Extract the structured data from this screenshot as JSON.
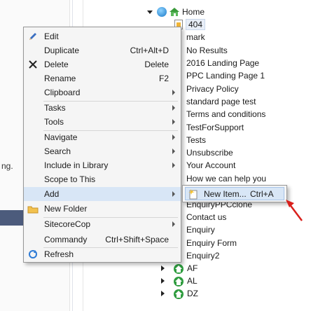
{
  "tree": {
    "root": "Home",
    "items": [
      {
        "label": "404",
        "icon": "doc-icon"
      },
      {
        "label": "mark"
      },
      {
        "label": "No Results"
      },
      {
        "label": "2016 Landing Page"
      },
      {
        "label": "PPC Landing Page 1"
      },
      {
        "label": "Privacy Policy"
      },
      {
        "label": "standard page test"
      },
      {
        "label": "Terms and conditions"
      },
      {
        "label": "TestForSupport"
      },
      {
        "label": "Tests"
      },
      {
        "label": "Unsubscribe"
      },
      {
        "label": "Your Account"
      },
      {
        "label": "How we can help you"
      },
      {
        "label": "EnquiryPPCclone"
      },
      {
        "label": "Contact us"
      },
      {
        "label": "Enquiry"
      },
      {
        "label": "Enquiry Form"
      },
      {
        "label": "Enquiry2"
      }
    ],
    "regions": [
      "AF",
      "AL",
      "DZ"
    ]
  },
  "left_partial_text": "ng.",
  "context_menu": {
    "items": [
      {
        "label": "Edit",
        "shortcut": "",
        "icon": "pencil-icon"
      },
      {
        "label": "Duplicate",
        "shortcut": "Ctrl+Alt+D"
      },
      {
        "label": "Delete",
        "shortcut": "Delete",
        "icon": "close-icon"
      },
      {
        "label": "Rename",
        "shortcut": "F2"
      },
      {
        "label": "Clipboard",
        "submenu": true
      },
      {
        "label": "Tasks",
        "submenu": true
      },
      {
        "label": "Tools",
        "submenu": true
      },
      {
        "label": "Navigate",
        "submenu": true
      },
      {
        "label": "Search",
        "submenu": true
      },
      {
        "label": "Include in Library",
        "submenu": true
      },
      {
        "label": "Scope to This"
      },
      {
        "label": "Add",
        "submenu": true,
        "highlighted": true
      },
      {
        "label": "New Folder",
        "icon": "folder-icon"
      },
      {
        "label": "SitecoreCop",
        "submenu": true
      },
      {
        "label": "Commandy",
        "shortcut": "Ctrl+Shift+Space"
      },
      {
        "label": "Refresh",
        "icon": "refresh-icon"
      }
    ]
  },
  "submenu": {
    "item_label": "New Item...",
    "item_shortcut": "Ctrl+A",
    "icon": "new-item-icon"
  },
  "colors": {
    "highlight": "#d8e6f6",
    "arrow_annotation": "#d9201c",
    "menu_bg": "#f5f5f5"
  }
}
